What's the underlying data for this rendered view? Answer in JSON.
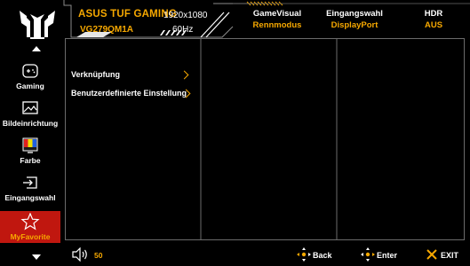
{
  "header": {
    "brand": "ASUS TUF GAMING",
    "model": "VG279QM1A",
    "resolution": "1920x1080",
    "refresh_rate": "60Hz",
    "status": [
      {
        "label": "GameVisual",
        "value": "Rennmodus"
      },
      {
        "label": "Eingangswahl",
        "value": "DisplayPort"
      },
      {
        "label": "HDR",
        "value": "AUS"
      }
    ]
  },
  "sidebar": {
    "items": [
      {
        "label": "Gaming",
        "icon": "gamepad-icon"
      },
      {
        "label": "Bildeinrichtung",
        "icon": "image-icon"
      },
      {
        "label": "Farbe",
        "icon": "color-icon"
      },
      {
        "label": "Eingangswahl",
        "icon": "input-icon"
      },
      {
        "label": "MyFavorite",
        "icon": "star-icon"
      }
    ]
  },
  "menu": {
    "items": [
      {
        "label": "Verknüpfung"
      },
      {
        "label": "Benutzerdefinierte Einstellung"
      }
    ]
  },
  "footer": {
    "volume": "50",
    "back": "Back",
    "enter": "Enter",
    "exit": "EXIT"
  },
  "colors": {
    "accent": "#f6a800",
    "active": "#c0170f",
    "border": "#6b6b6b"
  }
}
